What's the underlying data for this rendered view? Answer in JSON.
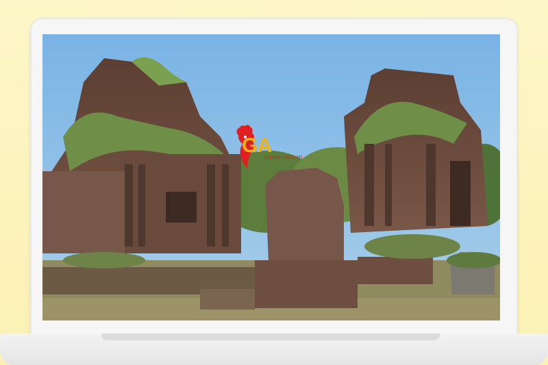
{
  "watermark": {
    "letters": "GA",
    "subtitle": "space.com.vn"
  },
  "colors": {
    "sky": "#8fbfe6",
    "brick": "#6a4a3c",
    "grass": "#7e8a55",
    "logo_red": "#e02020",
    "logo_gold": "#f0b21b"
  }
}
